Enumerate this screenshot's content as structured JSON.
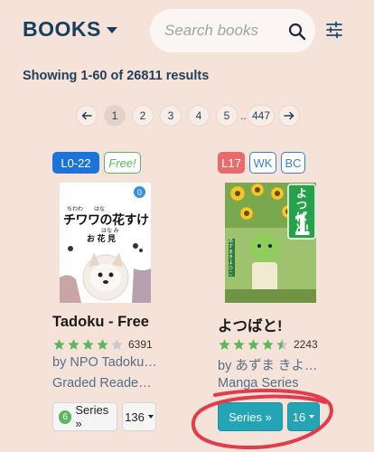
{
  "header": {
    "brand": "BOOKS",
    "search_placeholder": "Search books"
  },
  "results_text": "Showing 1-60 of 26811 results",
  "pagination": {
    "prev": "←",
    "pages": [
      "1",
      "2",
      "3",
      "4",
      "5"
    ],
    "ellipsis": "..",
    "last": "447",
    "next": "→",
    "active": "1"
  },
  "books": [
    {
      "level": "L0-22",
      "level_color": "#1c73d8",
      "tags": [
        "Free!"
      ],
      "cover_title": "チワワの花すけ",
      "cover_ruby": "ちわわ　　はな",
      "cover_sub": "お 花 見",
      "cover_sub_ruby": "はな み",
      "cover_badge": "0",
      "title": "Tadoku - Free",
      "rating": 4,
      "rating_count": "6391",
      "author": "by NPO Tadoku…",
      "series_name": "Graded Reade…",
      "series_count": "6",
      "series_label": "Series »",
      "volume": "136"
    },
    {
      "level": "L17",
      "level_color": "#e86b6b",
      "tags": [
        "WK",
        "BC"
      ],
      "cover_title": "よつばと!",
      "cover_author": "あずま きよひこ",
      "cover_volume": "1",
      "title": "よつばと!",
      "rating": 4.5,
      "rating_count": "2243",
      "author": "by あずま きよ…",
      "series_name": "Manga Series",
      "series_label": "Series »",
      "volume": "16"
    }
  ],
  "colors": {
    "background": "#f5e2d8",
    "brand": "#173e5d",
    "accent_teal": "#24a5b5",
    "star": "#5cb65c",
    "annotation_red": "#e23b4a"
  }
}
